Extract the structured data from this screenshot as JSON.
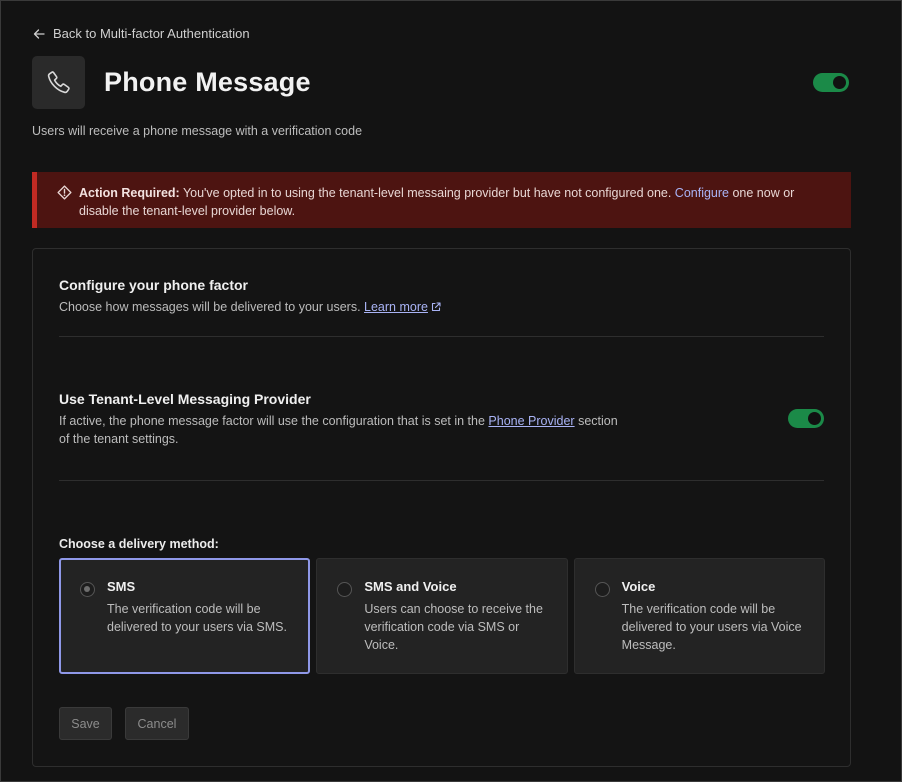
{
  "nav": {
    "back_label": "Back to Multi-factor Authentication"
  },
  "header": {
    "title": "Phone Message",
    "enabled": true
  },
  "subtitle": "Users will receive a phone message with a verification code",
  "alert": {
    "strong": "Action Required:",
    "text_before": " You've opted in to using the tenant-level messaing provider but have not configured one. ",
    "link": "Configure",
    "text_after": " one now or disable the tenant-level provider below."
  },
  "configure": {
    "title": "Configure your phone factor",
    "desc": "Choose how messages will be delivered to your users. ",
    "learn_more": "Learn more"
  },
  "tenant_provider": {
    "title": "Use Tenant-Level Messaging Provider",
    "desc_before": "If active, the phone message factor will use the configuration that is set in the ",
    "link": "Phone Provider",
    "desc_after_line1": " section",
    "desc_line2": "of the tenant settings.",
    "enabled": true
  },
  "delivery": {
    "label": "Choose a delivery method:",
    "selected": "SMS",
    "options": [
      {
        "title": "SMS",
        "desc": "The verification code will be delivered to your users via SMS."
      },
      {
        "title": "SMS and Voice",
        "desc": "Users can choose to receive the verification code via SMS or Voice."
      },
      {
        "title": "Voice",
        "desc": "The verification code will be delivered to your users via Voice Message."
      }
    ]
  },
  "actions": {
    "save": "Save",
    "cancel": "Cancel"
  },
  "colors": {
    "accent_green": "#1b8a48",
    "alert_bg": "#4d1411",
    "alert_border": "#c22a23",
    "link": "#a9b3f5",
    "selected_border": "#8f98e8"
  }
}
